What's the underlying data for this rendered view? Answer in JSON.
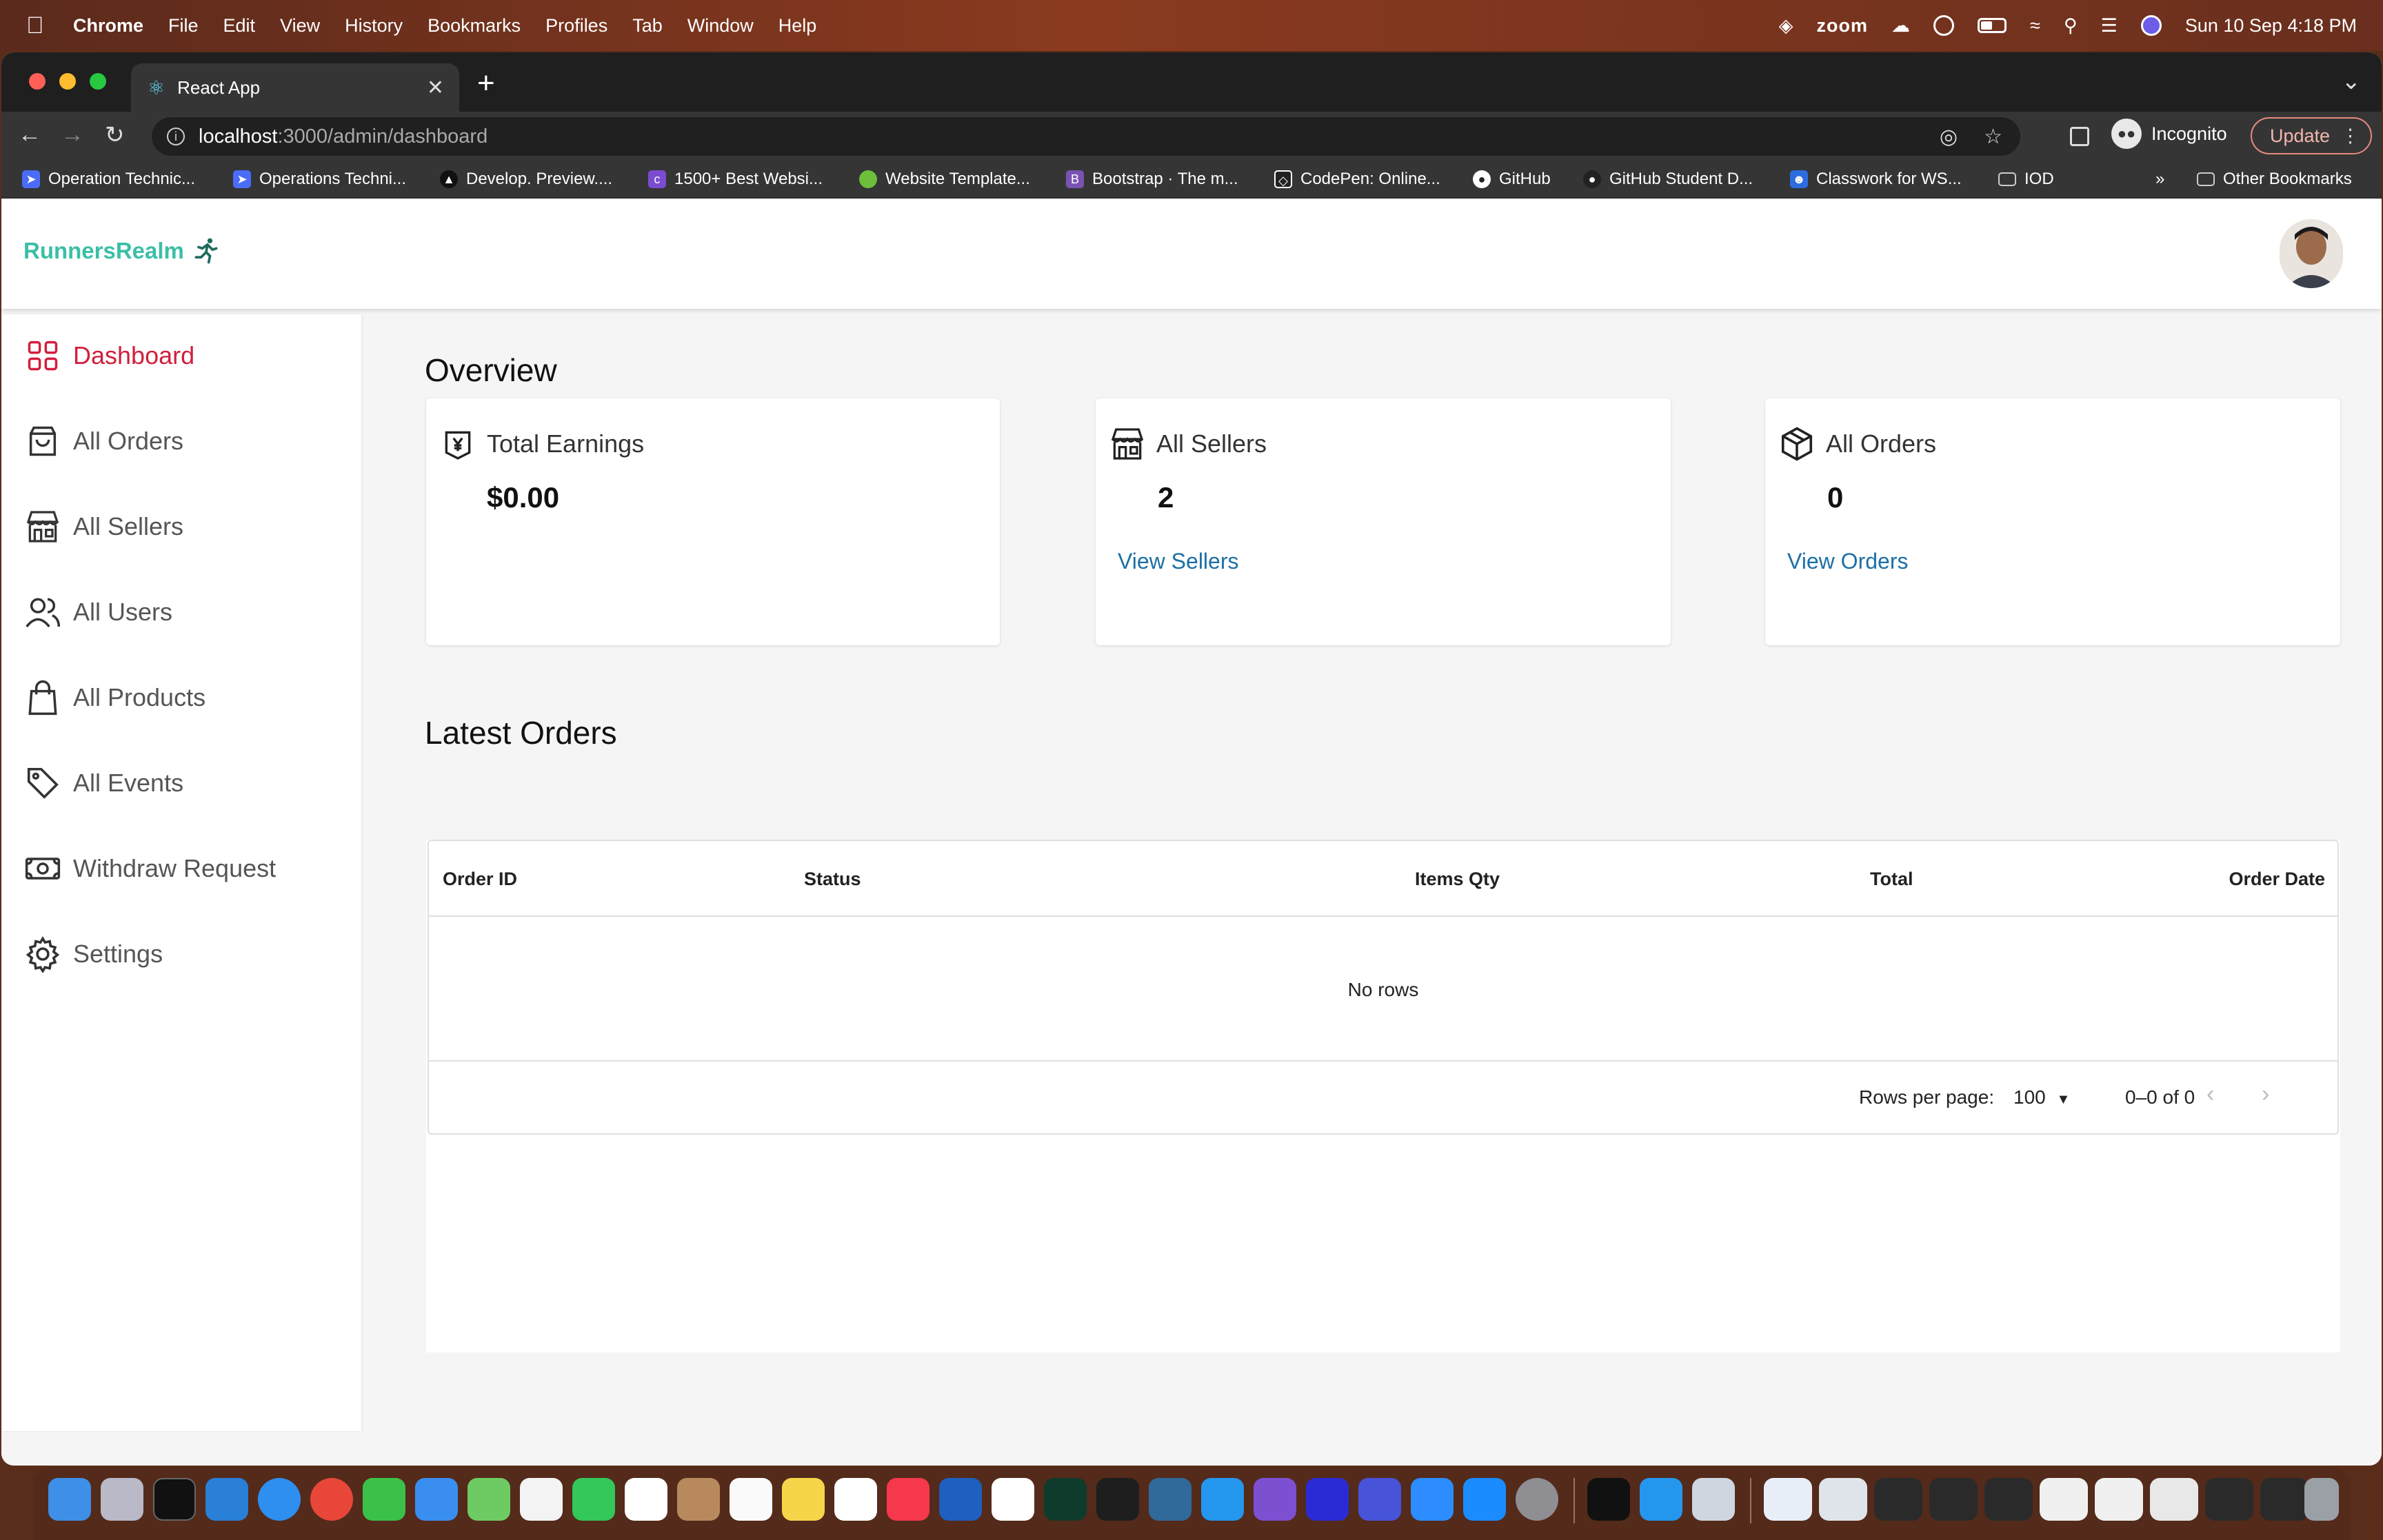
{
  "menubar": {
    "app": "Chrome",
    "menus": [
      "File",
      "Edit",
      "View",
      "History",
      "Bookmarks",
      "Profiles",
      "Tab",
      "Window",
      "Help"
    ],
    "zoom": "zoom",
    "datetime": "Sun 10 Sep  4:18 PM"
  },
  "browser": {
    "tab_title": "React App",
    "url_host": "localhost",
    "url_path": ":3000/admin/dashboard",
    "profile": "Incognito",
    "update_label": "Update",
    "bookmarks": [
      {
        "label": "Operation Technic...",
        "color": "#4a6cf7"
      },
      {
        "label": "Operations Techni...",
        "color": "#4a6cf7"
      },
      {
        "label": "Develop. Preview....",
        "color": "#111111"
      },
      {
        "label": "1500+ Best Websi...",
        "color": "#7b4bd1"
      },
      {
        "label": "Website Template...",
        "color": "#6dbf3b"
      },
      {
        "label": "Bootstrap · The m...",
        "color": "#7952b3"
      },
      {
        "label": "CodePen: Online...",
        "color": "#222222"
      },
      {
        "label": "GitHub",
        "color": "#222222"
      },
      {
        "label": "GitHub Student D...",
        "color": "#222222"
      },
      {
        "label": "Classwork for WS...",
        "color": "#2d6cdf"
      },
      {
        "label": "IOD",
        "color": "#555555"
      }
    ],
    "more_bookmarks": "»",
    "other_bookmarks": "Other Bookmarks"
  },
  "app": {
    "brand": "RunnersRealm",
    "sidebar": [
      {
        "label": "Dashboard",
        "icon": "dashboard-grid-icon",
        "active": true
      },
      {
        "label": "All Orders",
        "icon": "shopping-bag-icon",
        "active": false
      },
      {
        "label": "All Sellers",
        "icon": "storefront-icon",
        "active": false
      },
      {
        "label": "All Users",
        "icon": "users-icon",
        "active": false
      },
      {
        "label": "All Products",
        "icon": "product-bag-icon",
        "active": false
      },
      {
        "label": "All Events",
        "icon": "tag-icon",
        "active": false
      },
      {
        "label": "Withdraw Request",
        "icon": "cash-icon",
        "active": false
      },
      {
        "label": "Settings",
        "icon": "gear-icon",
        "active": false
      }
    ],
    "overview": {
      "heading": "Overview",
      "cards": [
        {
          "title": "Total Earnings",
          "value": "$0.00",
          "link": ""
        },
        {
          "title": "All Sellers",
          "value": "2",
          "link": "View Sellers"
        },
        {
          "title": "All Orders",
          "value": "0",
          "link": "View Orders"
        }
      ]
    },
    "latest_orders": {
      "heading": "Latest Orders",
      "columns": [
        "Order ID",
        "Status",
        "Items Qty",
        "Total",
        "Order Date"
      ],
      "empty_text": "No rows",
      "rows_per_page_label": "Rows per page:",
      "rows_per_page_value": "100",
      "range_text": "0–0 of 0"
    }
  },
  "colors": {
    "brand": "#3bbfa7",
    "active": "#d21e3c",
    "link": "#1d6fa5"
  }
}
